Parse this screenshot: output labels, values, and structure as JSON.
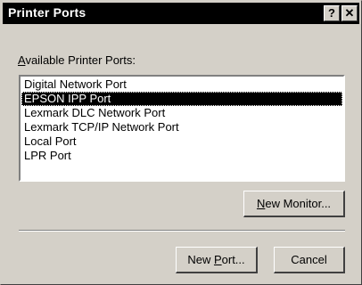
{
  "window": {
    "title": "Printer Ports",
    "help_glyph": "?",
    "close_glyph": "✕"
  },
  "available": {
    "label_mnemonic": "A",
    "label_rest": "vailable Printer Ports:"
  },
  "ports": [
    {
      "label": "Digital Network Port",
      "selected": false
    },
    {
      "label": "EPSON IPP Port",
      "selected": true
    },
    {
      "label": "Lexmark DLC Network Port",
      "selected": false
    },
    {
      "label": "Lexmark TCP/IP Network Port",
      "selected": false
    },
    {
      "label": "Local Port",
      "selected": false
    },
    {
      "label": "LPR Port",
      "selected": false
    }
  ],
  "buttons": {
    "new_monitor_mnemonic": "N",
    "new_monitor_rest": "ew Monitor...",
    "new_port_pre": "New ",
    "new_port_mnemonic": "P",
    "new_port_rest": "ort...",
    "cancel": "Cancel"
  },
  "colors": {
    "face": "#d4d0c8",
    "titlebar": "#000000",
    "selection": "#000000"
  }
}
